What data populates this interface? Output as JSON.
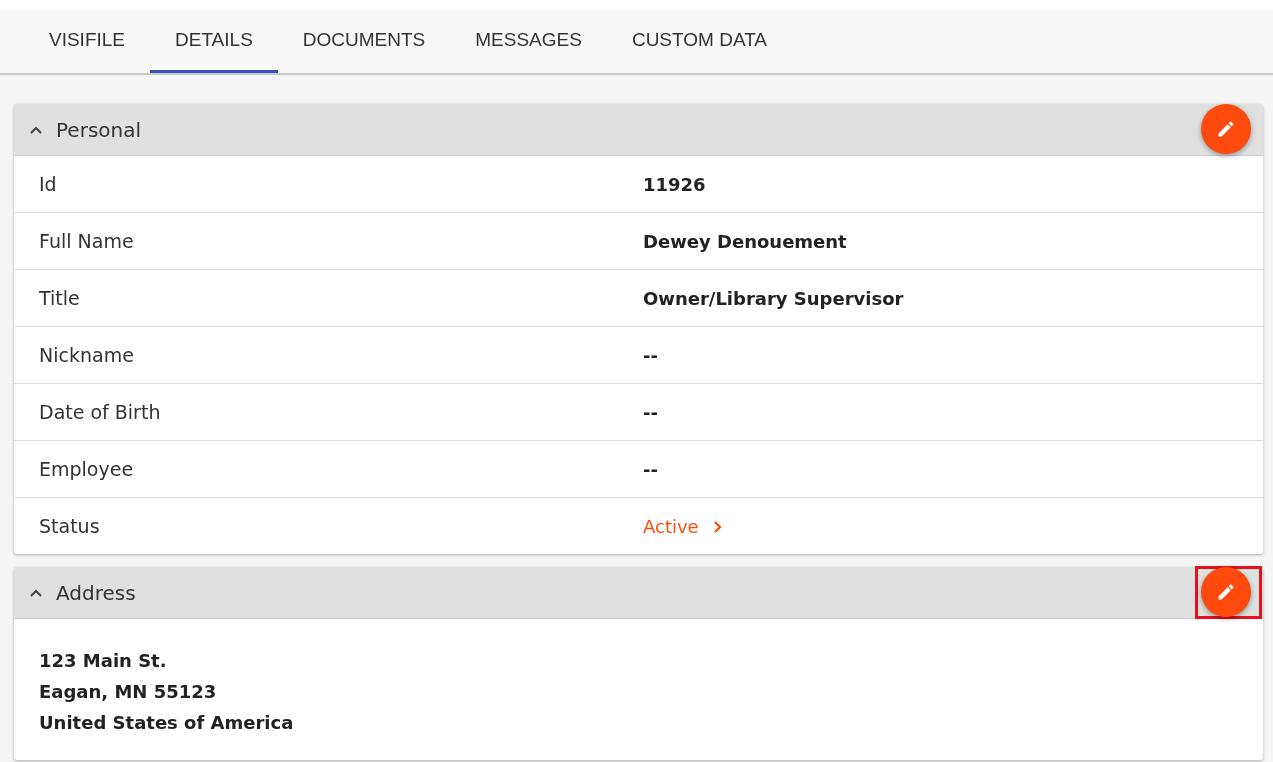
{
  "tabs": [
    {
      "label": "VISIFILE",
      "selected": false
    },
    {
      "label": "DETAILS",
      "selected": true
    },
    {
      "label": "DOCUMENTS",
      "selected": false
    },
    {
      "label": "MESSAGES",
      "selected": false
    },
    {
      "label": "CUSTOM DATA",
      "selected": false
    }
  ],
  "sections": [
    {
      "kind": "fields",
      "title": "Personal",
      "expanded": true,
      "edit_highlighted": false,
      "rows": [
        {
          "label": "Id",
          "value": "11926",
          "kind": "text"
        },
        {
          "label": "Full Name",
          "value": "Dewey Denouement",
          "kind": "text"
        },
        {
          "label": "Title",
          "value": "Owner/Library Supervisor",
          "kind": "text"
        },
        {
          "label": "Nickname",
          "value": "--",
          "kind": "text"
        },
        {
          "label": "Date of Birth",
          "value": "--",
          "kind": "text"
        },
        {
          "label": "Employee",
          "value": "--",
          "kind": "text"
        },
        {
          "label": "Status",
          "value": "Active",
          "kind": "link"
        }
      ]
    },
    {
      "kind": "address",
      "title": "Address",
      "expanded": true,
      "edit_highlighted": true,
      "lines": [
        "123 Main St.",
        "Eagan, MN 55123",
        "United States of America"
      ]
    }
  ]
}
